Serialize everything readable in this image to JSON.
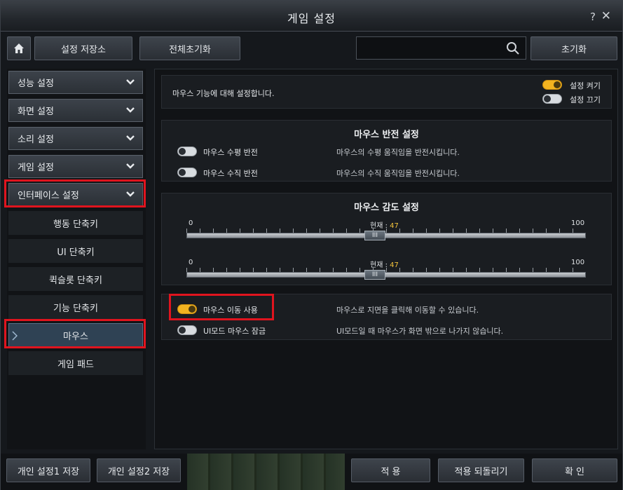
{
  "window": {
    "title": "게임 설정",
    "help": "?",
    "close": "✕"
  },
  "toolbar": {
    "save_store": "설정 저장소",
    "reset_all": "전체초기화",
    "search_placeholder": "",
    "reset": "초기화"
  },
  "sidebar": {
    "categories": [
      {
        "label": "성능 설정"
      },
      {
        "label": "화면 설정"
      },
      {
        "label": "소리 설정"
      },
      {
        "label": "게임 설정"
      },
      {
        "label": "인터페이스 설정"
      }
    ],
    "subitems": [
      {
        "label": "행동 단축키"
      },
      {
        "label": "UI 단축키"
      },
      {
        "label": "퀵슬롯 단축키"
      },
      {
        "label": "기능 단축키"
      },
      {
        "label": "마우스"
      },
      {
        "label": "게임 패드"
      }
    ]
  },
  "main": {
    "intro": "마우스 기능에 대해 설정합니다.",
    "setting_on": "설정 켜기",
    "setting_off": "설정 끄기",
    "invert": {
      "title": "마우스 반전 설정",
      "rows": [
        {
          "label": "마우스 수평 반전",
          "desc": "마우스의 수평 움직임을 반전시킵니다."
        },
        {
          "label": "마우스 수직 반전",
          "desc": "마우스의 수직 움직임을 반전시킵니다."
        }
      ]
    },
    "sensitivity": {
      "title": "마우스 감도 설정",
      "min": "0",
      "max": "100",
      "current_label": "현재 :",
      "sliders": [
        {
          "value": "47"
        },
        {
          "value": "47"
        }
      ],
      "thumb_glyph": "III"
    },
    "move": {
      "rows": [
        {
          "label": "마우스 이동 사용",
          "desc": "마우스로 지면을 클릭해 이동할 수 있습니다.",
          "on": true
        },
        {
          "label": "UI모드 마우스 잠금",
          "desc": "UI모드일 때 마우스가 화면 밖으로 나가지 않습니다.",
          "on": false
        }
      ]
    }
  },
  "bottom": {
    "save1": "개인 설정1 저장",
    "save2": "개인 설정2 저장",
    "apply": "적 용",
    "revert": "적용 되돌리기",
    "ok": "확 인"
  },
  "colors": {
    "accent": "#f2b320",
    "highlight": "#e0141e",
    "active": "#2f4254"
  }
}
